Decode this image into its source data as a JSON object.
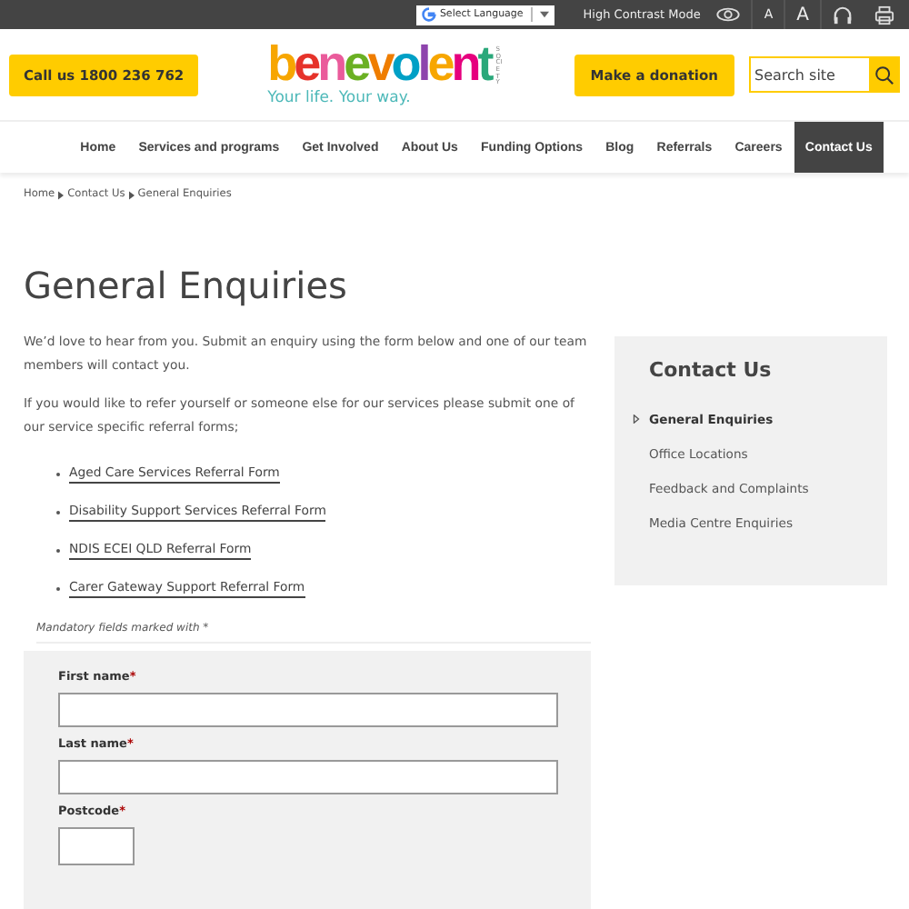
{
  "top_bar": {
    "language_select": "Select Language",
    "contrast_label": "High Contrast Mode",
    "font_small": "A",
    "font_large": "A"
  },
  "header": {
    "call_button": "Call us 1800 236 762",
    "logo": {
      "wordmark": "benevolent",
      "society": "SOCIETY",
      "tagline": "Your life. Your way."
    },
    "donate_button": "Make a donation",
    "search": {
      "placeholder": "Search site"
    }
  },
  "nav": [
    {
      "label": "Home",
      "selected": false
    },
    {
      "label": "Services and programs",
      "selected": false
    },
    {
      "label": "Get Involved",
      "selected": false
    },
    {
      "label": "About Us",
      "selected": false
    },
    {
      "label": "Funding Options",
      "selected": false
    },
    {
      "label": "Blog",
      "selected": false
    },
    {
      "label": "Referrals",
      "selected": false
    },
    {
      "label": "Careers",
      "selected": false
    },
    {
      "label": "Contact Us",
      "selected": true
    }
  ],
  "breadcrumb": [
    "Home",
    "Contact Us",
    "General Enquiries"
  ],
  "page_title": "General Enquiries",
  "intro": [
    "We’d love to hear from you. Submit an enquiry using the form below and one of our team members will contact you.",
    "If you would like to refer yourself or someone else for our services please submit one of our service specific referral forms;"
  ],
  "referral_links": [
    "Aged Care Services Referral Form",
    "Disability Support Services Referral Form",
    "NDIS ECEI QLD Referral Form",
    "Carer Gateway Support Referral Form"
  ],
  "mandatory_note": "Mandatory fields marked with *",
  "form_fields": [
    {
      "label": "First name",
      "required_mark": "*",
      "kind": "wide"
    },
    {
      "label": "Last name",
      "required_mark": "*",
      "kind": "wide"
    },
    {
      "label": "Postcode",
      "required_mark": "*",
      "kind": "short"
    }
  ],
  "sidebar": {
    "title": "Contact Us",
    "items": [
      {
        "label": "General Enquiries",
        "selected": true
      },
      {
        "label": "Office Locations",
        "selected": false
      },
      {
        "label": "Feedback and Complaints",
        "selected": false
      },
      {
        "label": "Media Centre Enquiries",
        "selected": false
      }
    ]
  }
}
